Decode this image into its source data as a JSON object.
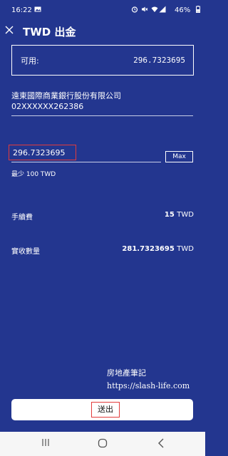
{
  "status_bar": {
    "time": "16:22",
    "battery": "46%",
    "icons": [
      "image-icon",
      "alarm-icon",
      "mute-icon",
      "wifi-icon",
      "signal-icon",
      "battery-icon"
    ]
  },
  "header": {
    "title": "TWD 出金"
  },
  "available": {
    "label": "可用:",
    "value": "296.7323695"
  },
  "bank": {
    "name": "遠東國際商業銀行股份有限公司",
    "account": "02XXXXXX262386"
  },
  "amount": {
    "value": "296.7323695",
    "max_label": "Max",
    "min_hint": "最少 100 TWD"
  },
  "fee": {
    "label": "手續費",
    "value": "15",
    "unit": "TWD"
  },
  "received": {
    "label": "實收數量",
    "value": "281.7323695",
    "unit": "TWD"
  },
  "watermark": {
    "line1": "房地產筆記",
    "line2": "https://slash-life.com"
  },
  "submit": {
    "label": "送出"
  },
  "nav": {
    "recents": "|||",
    "home": "◯",
    "back": "<"
  }
}
